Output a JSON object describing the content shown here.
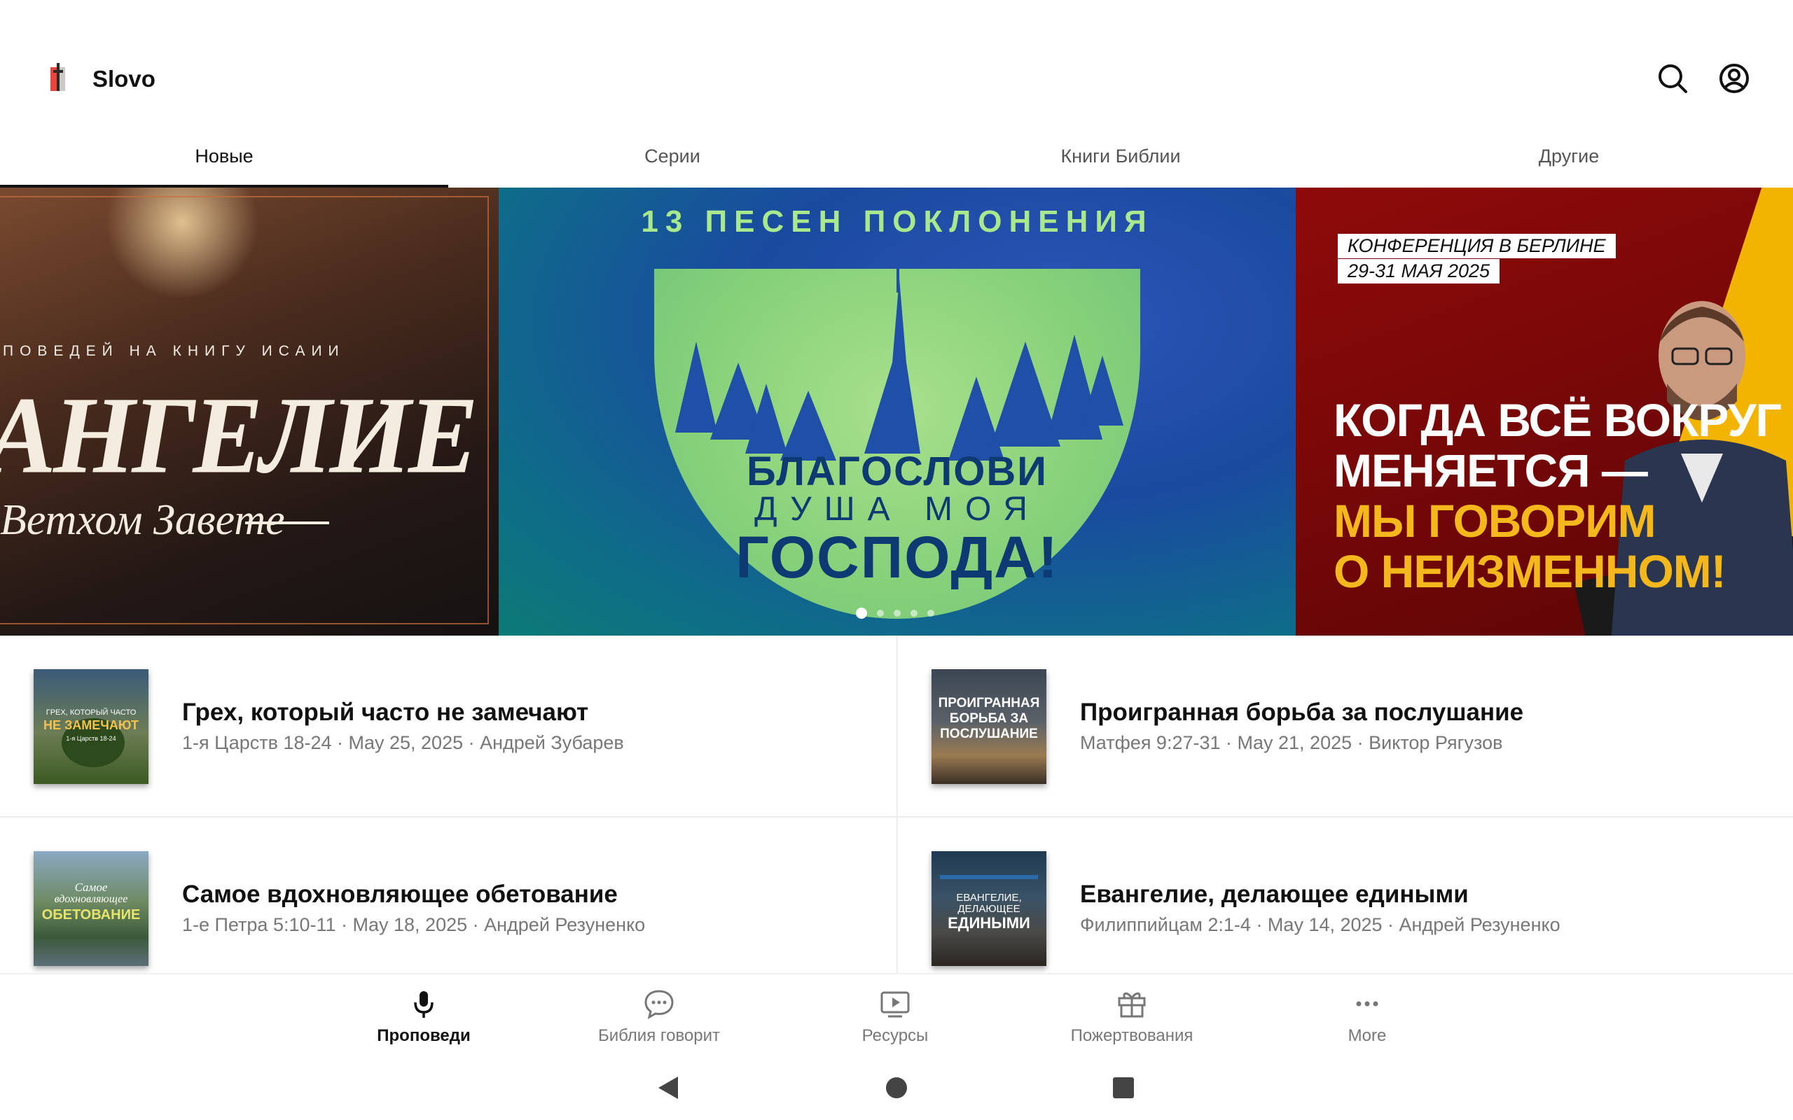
{
  "app": {
    "title": "Slovo"
  },
  "tabs": [
    {
      "label": "Новые",
      "active": true
    },
    {
      "label": "Серии",
      "active": false
    },
    {
      "label": "Книги Библии",
      "active": false
    },
    {
      "label": "Другие",
      "active": false
    }
  ],
  "carousel": {
    "slide1": {
      "kicker": "ПОВЕДЕЙ НА КНИГУ ИСАИИ",
      "title": "АНГЕЛИЕ",
      "subtitle": "Ветхом Завете"
    },
    "slide2": {
      "kicker": "13 ПЕСЕН ПОКЛОНЕНИЯ",
      "line1": "БЛАГОСЛОВИ",
      "line2": "ДУША МОЯ",
      "line3": "ГОСПОДА!"
    },
    "slide3": {
      "tag1": "КОНФЕРЕНЦИЯ В БЕРЛИНЕ",
      "tag2": "29-31 МАЯ 2025",
      "line1": "КОГДА ВСЁ ВОКРУГ",
      "line2": "МЕНЯЕТСЯ —",
      "line3": "МЫ ГОВОРИМ",
      "line4": "О НЕИЗМЕННОМ!"
    },
    "dots": {
      "count": 5,
      "active": 1
    }
  },
  "sermons": [
    {
      "title": "Грех, который часто не замечают",
      "meta": "1-я Царств 18-24 · May 25, 2025 · Андрей Зубарев",
      "thumb_text": "ГРЕХ, КОТОРЫЙ ЧАСТО",
      "thumb_text2": "НЕ ЗАМЕЧАЮТ",
      "thumb_text3": "1-я Царств 18-24"
    },
    {
      "title": "Проигранная борьба за послушание",
      "meta": "Матфея 9:27-31 · May 21, 2025 · Виктор Рягузов",
      "thumb_text": "ПРОИГРАННАЯ",
      "thumb_text2": "БОРЬБА ЗА",
      "thumb_text3": "ПОСЛУШАНИЕ"
    },
    {
      "title": "Самое вдохновляющее обетование",
      "meta": "1-е Петра 5:10-11 · May 18, 2025 · Андрей Резуненко",
      "thumb_text": "Самое",
      "thumb_text2": "вдохновляющее",
      "thumb_text3": "ОБЕТОВАНИЕ"
    },
    {
      "title": "Евангелие, делающее едиными",
      "meta": "Филиппийцам 2:1-4 · May 14, 2025 · Андрей Резуненко",
      "thumb_text": "ЕВАНГЕЛИЕ,",
      "thumb_text2": "ДЕЛАЮЩЕЕ",
      "thumb_text3": "ЕДИНЫМИ"
    }
  ],
  "bottom_nav": [
    {
      "label": "Проповеди",
      "icon": "microphone-icon",
      "active": true
    },
    {
      "label": "Библия говорит",
      "icon": "chat-bubble-icon",
      "active": false
    },
    {
      "label": "Ресурсы",
      "icon": "tv-play-icon",
      "active": false
    },
    {
      "label": "Пожертвования",
      "icon": "gift-icon",
      "active": false
    },
    {
      "label": "More",
      "icon": "more-dots-icon",
      "active": false
    }
  ],
  "colors": {
    "accent": "#111111",
    "muted": "#777777",
    "divider": "#ececec"
  }
}
